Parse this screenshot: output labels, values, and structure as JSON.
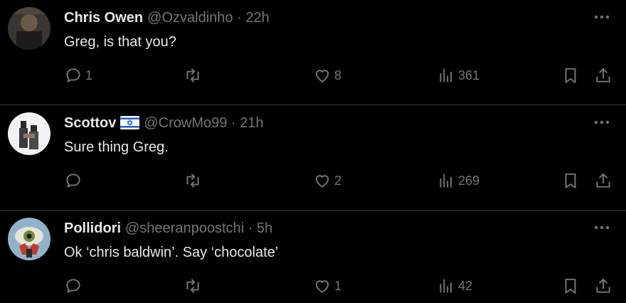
{
  "tweets": [
    {
      "name": "Chris Owen",
      "handle": "@Ozvaldinho",
      "separator": "·",
      "time": "22h",
      "text": "Greg, is that you?",
      "reply_count": "1",
      "retweet_count": "",
      "like_count": "8",
      "view_count": "361",
      "flag": false
    },
    {
      "name": "Scottov",
      "handle": "@CrowMo99",
      "separator": "·",
      "time": "21h",
      "text": "Sure thing Greg.",
      "reply_count": "",
      "retweet_count": "",
      "like_count": "2",
      "view_count": "269",
      "flag": true
    },
    {
      "name": "Pollidori",
      "handle": "@sheeranpoostchi",
      "separator": "·",
      "time": "5h",
      "text": "Ok ‘chris baldwin’. Say ‘chocolate’",
      "reply_count": "",
      "retweet_count": "",
      "like_count": "1",
      "view_count": "42",
      "flag": false
    }
  ],
  "colors": {
    "background": "#000000",
    "primary_text": "#e7e9ea",
    "secondary_text": "#71767b",
    "divider": "#2f3336"
  },
  "icons": [
    "reply-icon",
    "retweet-icon",
    "like-icon",
    "views-icon",
    "bookmark-icon",
    "share-icon",
    "more-icon",
    "israel-flag-icon"
  ]
}
